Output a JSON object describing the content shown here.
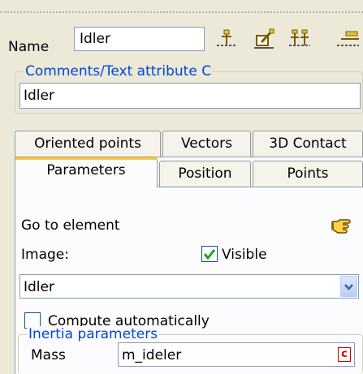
{
  "header": {
    "name_label": "Name",
    "name_value": "Idler"
  },
  "toolbar": {
    "icons": [
      "add-node-icon",
      "edit-node-icon",
      "add-multiple-nodes-icon",
      "remove-node-icon"
    ]
  },
  "comments": {
    "legend": "Comments/Text attribute C",
    "value": "Idler"
  },
  "tabs": {
    "row1": [
      "Oriented points",
      "Vectors",
      "3D Contact"
    ],
    "row2": [
      "Parameters",
      "Position",
      "Points"
    ],
    "active": "Parameters"
  },
  "parameters": {
    "go_to_element": "Go to element",
    "go_to_icon": "pointing-hand-icon",
    "image_label": "Image:",
    "visible_label": "Visible",
    "visible_checked": true,
    "image_select_value": "Idler",
    "compute_auto_label": "Compute automatically",
    "compute_auto_checked": false,
    "inertia_legend": "Inertia parameters",
    "mass_label": "Mass",
    "mass_value": "m_ideler",
    "mass_badge": "c"
  },
  "colors": {
    "legend_blue": "#0046d5",
    "active_tab_accent": "#ffc83c",
    "check_green": "#21a121",
    "badge_red": "#cc0000"
  }
}
